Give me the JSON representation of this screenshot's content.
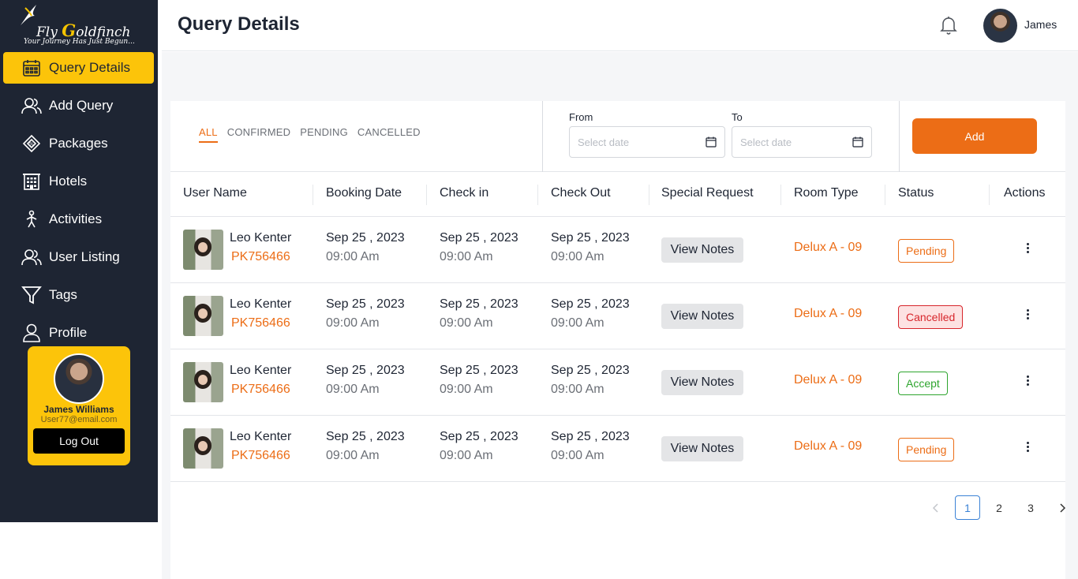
{
  "brand": {
    "name_prefix": "Fly ",
    "name_accent": "G",
    "name_suffix": "oldfinch",
    "tagline": "Your Journey Has Just Begun..."
  },
  "sidebar": {
    "items": [
      {
        "label": "Query Details",
        "icon": "calendar-icon",
        "active": true
      },
      {
        "label": "Add Query",
        "icon": "users-icon",
        "active": false
      },
      {
        "label": "Packages",
        "icon": "package-tag-icon",
        "active": false
      },
      {
        "label": "Hotels",
        "icon": "building-icon",
        "active": false
      },
      {
        "label": "Activities",
        "icon": "person-walking-icon",
        "active": false
      },
      {
        "label": "User Listing",
        "icon": "users-icon",
        "active": false
      },
      {
        "label": "Tags",
        "icon": "filter-icon",
        "active": false
      },
      {
        "label": "Profile",
        "icon": "user-icon",
        "active": false
      }
    ],
    "user_card": {
      "name": "James Williams",
      "email": "User77@email.com",
      "logout_label": "Log Out"
    }
  },
  "header": {
    "title": "Query Details",
    "username": "James"
  },
  "filters": {
    "tabs": [
      {
        "label": "ALL",
        "active": true
      },
      {
        "label": "CONFIRMED",
        "active": false
      },
      {
        "label": "PENDING",
        "active": false
      },
      {
        "label": "CANCELLED",
        "active": false
      }
    ],
    "from_label": "From",
    "to_label": "To",
    "date_placeholder": "Select date",
    "add_label": "Add"
  },
  "table": {
    "columns": [
      "User Name",
      "Booking Date",
      "Check in",
      "Check Out",
      "Special Request",
      "Room Type",
      "Status",
      "Actions"
    ],
    "rows": [
      {
        "name": "Leo Kenter",
        "code": "PK756466",
        "booking": [
          "Sep 25 , 2023",
          "09:00 Am"
        ],
        "checkin": [
          "Sep 25 , 2023",
          "09:00 Am"
        ],
        "checkout": [
          "Sep 25 , 2023",
          "09:00 Am"
        ],
        "request": "View Notes",
        "room": "Delux A - 09",
        "status": "Pending",
        "status_kind": "pending"
      },
      {
        "name": "Leo Kenter",
        "code": "PK756466",
        "booking": [
          "Sep 25 , 2023",
          "09:00 Am"
        ],
        "checkin": [
          "Sep 25 , 2023",
          "09:00 Am"
        ],
        "checkout": [
          "Sep 25 , 2023",
          "09:00 Am"
        ],
        "request": "View Notes",
        "room": "Delux A - 09",
        "status": "Cancelled",
        "status_kind": "cancelled"
      },
      {
        "name": "Leo Kenter",
        "code": "PK756466",
        "booking": [
          "Sep 25 , 2023",
          "09:00 Am"
        ],
        "checkin": [
          "Sep 25 , 2023",
          "09:00 Am"
        ],
        "checkout": [
          "Sep 25 , 2023",
          "09:00 Am"
        ],
        "request": "View Notes",
        "room": "Delux A - 09",
        "status": "Accept",
        "status_kind": "accept"
      },
      {
        "name": "Leo Kenter",
        "code": "PK756466",
        "booking": [
          "Sep 25 , 2023",
          "09:00 Am"
        ],
        "checkin": [
          "Sep 25 , 2023",
          "09:00 Am"
        ],
        "checkout": [
          "Sep 25 , 2023",
          "09:00 Am"
        ],
        "request": "View Notes",
        "room": "Delux A - 09",
        "status": "Pending",
        "status_kind": "pending"
      }
    ]
  },
  "pagination": {
    "pages": [
      "1",
      "2",
      "3"
    ],
    "current": "1"
  },
  "colors": {
    "sidebar_bg": "#1e2533",
    "accent_yellow": "#fcc40a",
    "accent_orange": "#ec6d16",
    "cancelled_red": "#d7262c",
    "accept_green": "#2ea52e",
    "pagination_blue": "#3b82d6"
  }
}
